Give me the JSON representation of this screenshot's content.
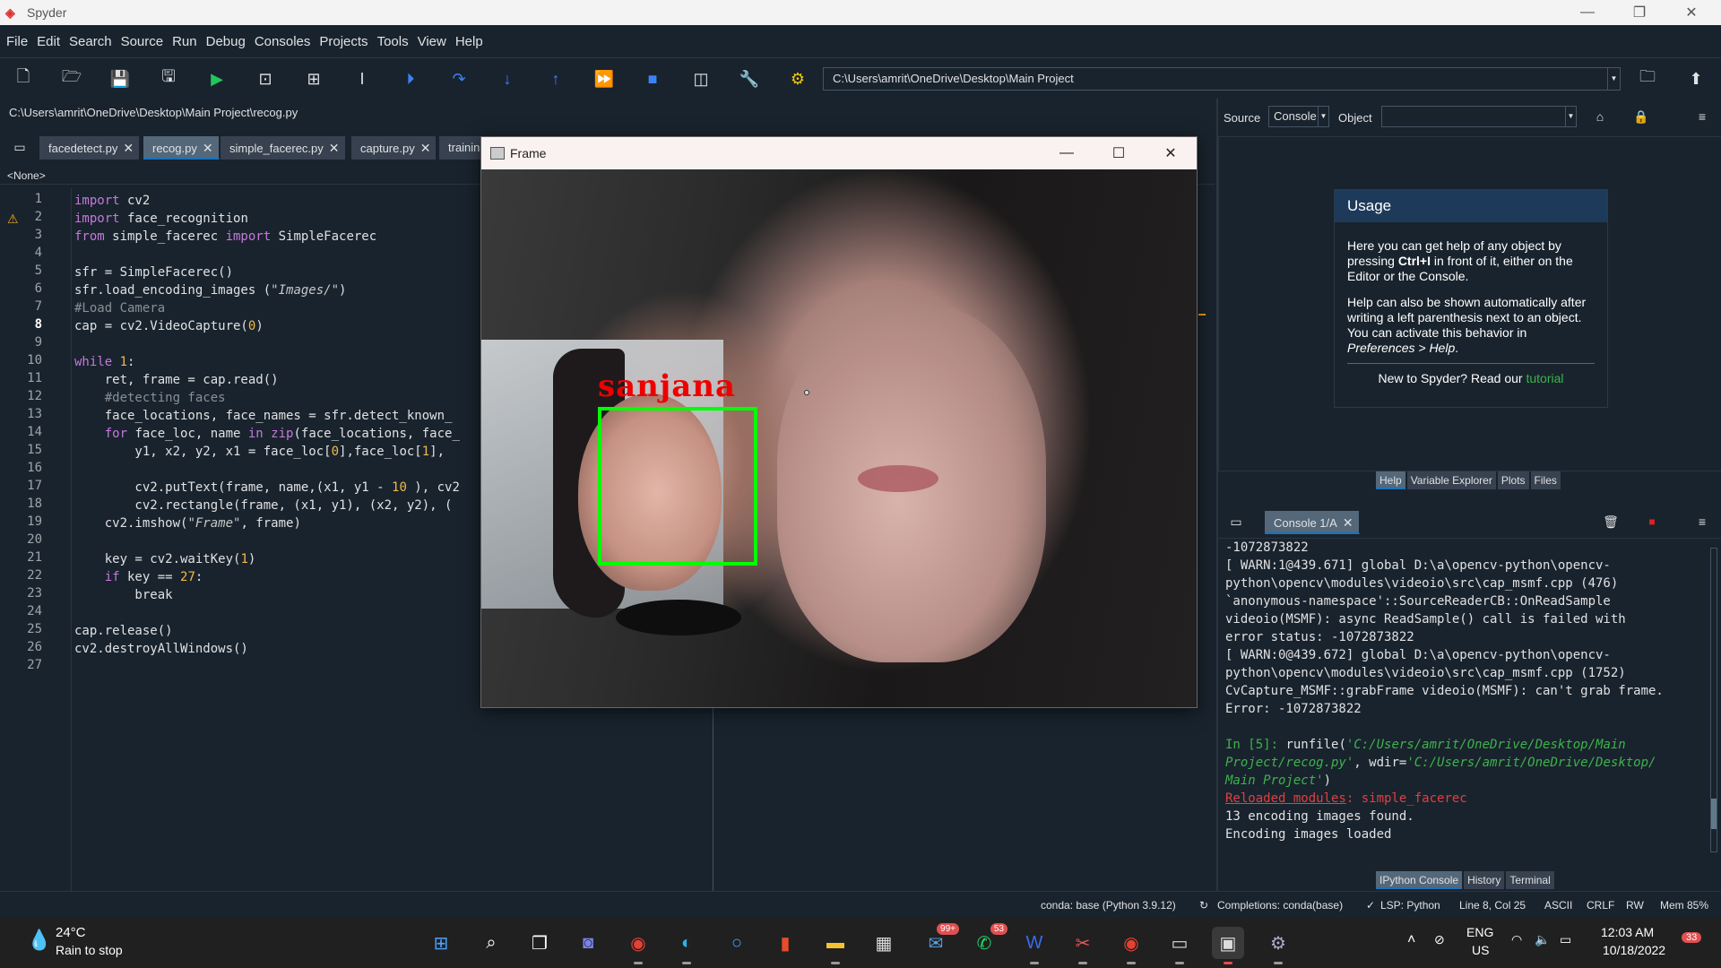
{
  "window": {
    "title": "Spyder",
    "minimize": "—",
    "maximize": "❐",
    "close": "✕"
  },
  "menu": [
    "File",
    "Edit",
    "Search",
    "Source",
    "Run",
    "Debug",
    "Consoles",
    "Projects",
    "Tools",
    "View",
    "Help"
  ],
  "toolbar": {
    "path": "C:\\Users\\amrit\\OneDrive\\Desktop\\Main Project"
  },
  "editor": {
    "file_path": "C:\\Users\\amrit\\OneDrive\\Desktop\\Main Project\\recog.py",
    "tabs": [
      {
        "label": "facedetect.py"
      },
      {
        "label": "recog.py"
      },
      {
        "label": "simple_facerec.py"
      },
      {
        "label": "capture.py"
      },
      {
        "label": "trainin"
      }
    ],
    "class_selector": "<None>",
    "current_line": 8,
    "lines": [
      "import cv2",
      "import face_recognition",
      "from simple_facerec import SimpleFacerec",
      "",
      "sfr = SimpleFacerec()",
      "sfr.load_encoding_images (\"Images/\")",
      "#Load Camera",
      "cap = cv2.VideoCapture(0)",
      "",
      "while 1:",
      "    ret, frame = cap.read()",
      "    #detecting faces",
      "    face_locations, face_names = sfr.detect_known_",
      "    for face_loc, name in zip(face_locations, face_",
      "        y1, x2, y2, x1 = face_loc[0],face_loc[1], ",
      "",
      "        cv2.putText(frame, name,(x1, y1 - 10 ), cv2",
      "        cv2.rectangle(frame, (x1, y1), (x2, y2), (",
      "    cv2.imshow(\"Frame\", frame)",
      "",
      "    key = cv2.waitKey(1)",
      "    if key == 27:",
      "        break",
      "",
      "cap.release()",
      "cv2.destroyAllWindows()",
      ""
    ]
  },
  "frame_window": {
    "title": "Frame",
    "label": "sanjana",
    "minimize": "—",
    "maximize": "☐",
    "close": "✕"
  },
  "help": {
    "source_label": "Source",
    "source_value": "Console",
    "object_label": "Object",
    "object_value": "",
    "usage_title": "Usage",
    "p1a": "Here you can get help of any object by pressing ",
    "p1b": "Ctrl+I",
    "p1c": " in front of it, either on the Editor or the Console.",
    "p2a": "Help can also be shown automatically after writing a left parenthesis next to an object. You can activate this behavior in ",
    "p2b": "Preferences > Help",
    "p2c": ".",
    "foot_a": "New to Spyder? Read our ",
    "foot_b": "tutorial",
    "tabs": [
      "Help",
      "Variable Explorer",
      "Plots",
      "Files"
    ]
  },
  "console": {
    "tab": "Console 1/A",
    "lines": [
      "-1072873822",
      "[ WARN:1@439.671] global D:\\a\\opencv-python\\opencv-",
      "python\\opencv\\modules\\videoio\\src\\cap_msmf.cpp (476)",
      "`anonymous-namespace'::SourceReaderCB::OnReadSample",
      "videoio(MSMF): async ReadSample() call is failed with",
      "error status: -1072873822",
      "[ WARN:0@439.672] global D:\\a\\opencv-python\\opencv-",
      "python\\opencv\\modules\\videoio\\src\\cap_msmf.cpp (1752)",
      "CvCapture_MSMF::grabFrame videoio(MSMF): can't grab frame.",
      "Error: -1072873822",
      ""
    ],
    "prompt": "In [5]: ",
    "run_a": "runfile(",
    "run_b": "'C:/Users/amrit/OneDrive/Desktop/Main",
    "run_c": "Project/recog.py'",
    "run_d": ", wdir=",
    "run_e": "'C:/Users/amrit/OneDrive/Desktop/",
    "run_f": "Main Project'",
    "run_g": ")",
    "reloaded_a": "Reloaded modules",
    "reloaded_b": ": simple_facerec",
    "out1": "13 encoding images found.",
    "out2": "Encoding images loaded",
    "bottom_tabs": [
      "IPython Console",
      "History",
      "Terminal"
    ]
  },
  "status": {
    "conda": "conda: base (Python 3.9.12)",
    "completions": "Completions: conda(base)",
    "lsp": "LSP: Python",
    "position": "Line 8, Col 25",
    "encoding": "ASCII",
    "eol": "CRLF",
    "rw": "RW",
    "mem": "Mem 85%"
  },
  "taskbar": {
    "temp": "24°C",
    "weather": "Rain to stop",
    "lang1": "ENG",
    "lang2": "US",
    "time": "12:03 AM",
    "date": "10/18/2022",
    "notif": "33",
    "badge_mail": "99+",
    "badge_whatsapp": "53"
  }
}
